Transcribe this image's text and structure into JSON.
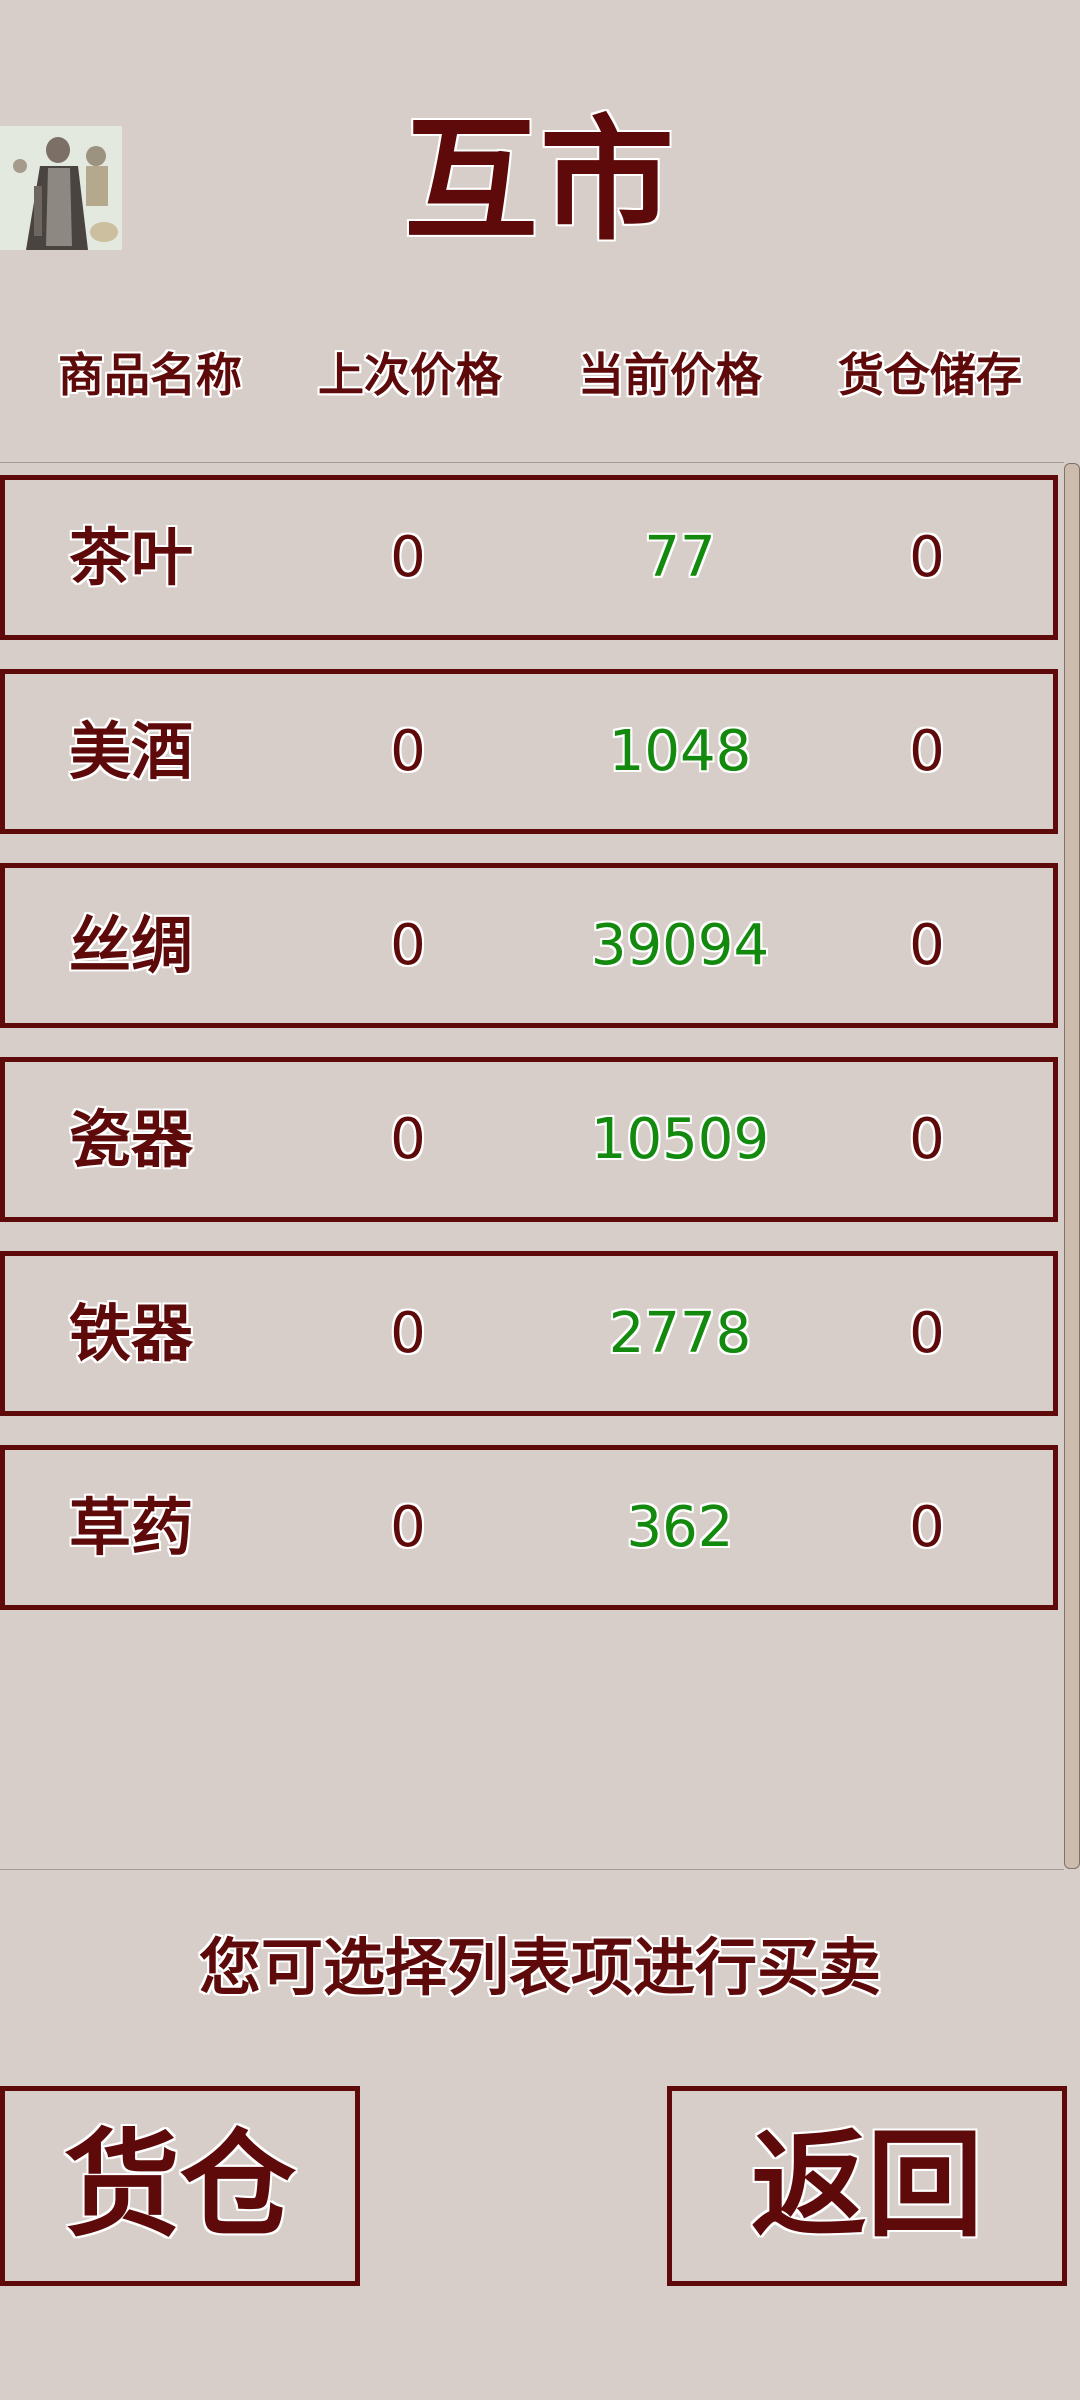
{
  "title": "互市",
  "headers": [
    "商品名称",
    "上次价格",
    "当前价格",
    "货仓储存"
  ],
  "rows": [
    {
      "name": "茶叶",
      "last_price": "0",
      "current_price": "77",
      "stock": "0"
    },
    {
      "name": "美酒",
      "last_price": "0",
      "current_price": "1048",
      "stock": "0"
    },
    {
      "name": "丝绸",
      "last_price": "0",
      "current_price": "39094",
      "stock": "0"
    },
    {
      "name": "瓷器",
      "last_price": "0",
      "current_price": "10509",
      "stock": "0"
    },
    {
      "name": "铁器",
      "last_price": "0",
      "current_price": "2778",
      "stock": "0"
    },
    {
      "name": "草药",
      "last_price": "0",
      "current_price": "362",
      "stock": "0"
    }
  ],
  "hint": "您可选择列表项进行买卖",
  "buttons": {
    "warehouse": "货仓",
    "back": "返回"
  },
  "colors": {
    "text": "#5e0a0a",
    "price": "#138a0e",
    "background": "#d7cec9"
  }
}
